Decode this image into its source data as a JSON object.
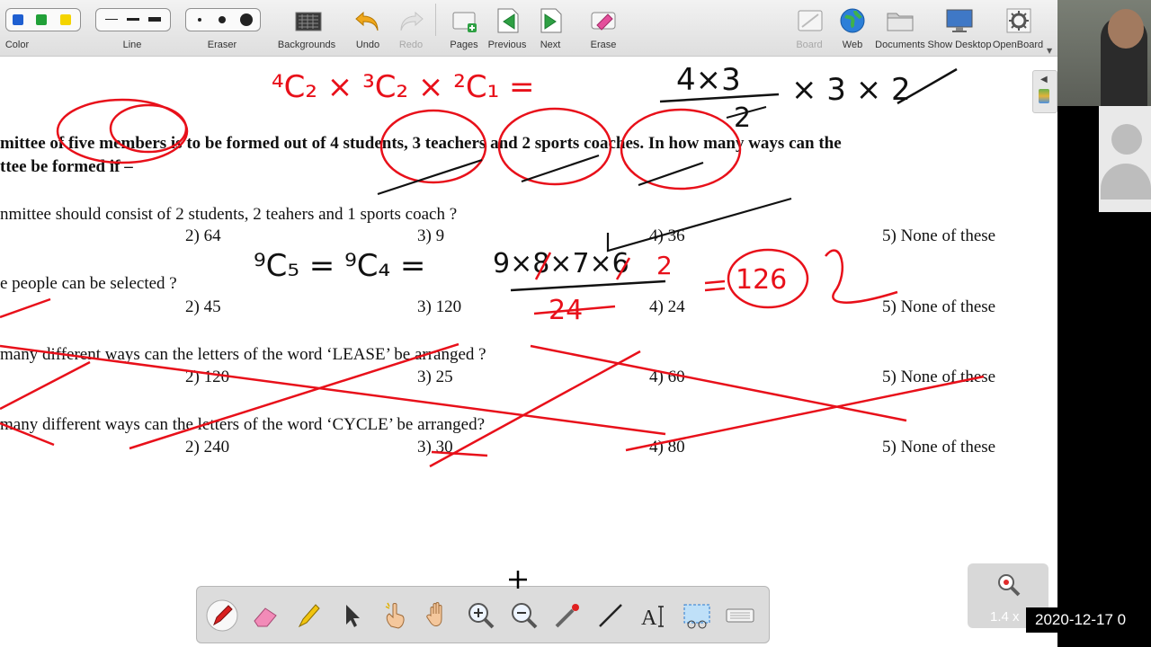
{
  "toolbar": {
    "color_label": "Color",
    "line_label": "Line",
    "eraser_label": "Eraser",
    "backgrounds_label": "Backgrounds",
    "undo_label": "Undo",
    "redo_label": "Redo",
    "pages_label": "Pages",
    "previous_label": "Previous",
    "next_label": "Next",
    "erase_label": "Erase",
    "board_label": "Board",
    "web_label": "Web",
    "documents_label": "Documents",
    "show_desktop_label": "Show Desktop",
    "openboard_label": "OpenBoard",
    "colors": [
      "#1f5fd1",
      "#21a038",
      "#f4d400"
    ],
    "icons": [
      "undo-icon",
      "redo-icon",
      "pages-icon",
      "previous-icon",
      "next-icon",
      "erase-icon",
      "board-icon",
      "web-globe-icon",
      "documents-folder-icon",
      "show-desktop-icon",
      "openboard-gear-icon"
    ]
  },
  "board": {
    "q1_line1": "mittee of five members is to be formed out of 4 students, 3 teachers and 2 sports coaches.  In how many ways can the",
    "q1_line2": "ttee be formed if –",
    "q1a": "nmittee should consist of 2 students, 2 teahers and 1 sports coach  ?",
    "q1a_options": [
      "2)  64",
      "3)  9",
      "4)  36",
      "5) None of these"
    ],
    "q1b": "e people can be selected  ?",
    "q1b_options": [
      "2)  45",
      "3)  120",
      "4)  24",
      "5) None of these"
    ],
    "q2": "many different ways can the letters of the word ‘LEASE’ be arranged ?",
    "q2_options": [
      "2) 120",
      "3)  25",
      "4) 60",
      "5) None of these"
    ],
    "q3": "many different ways can the letters of the word ‘CYCLE’ be arranged?",
    "q3_options": [
      "2)  240",
      "3)  30",
      "4)  80",
      "5) None of these"
    ]
  },
  "ink": {
    "red": "#e8101a",
    "black": "#111111",
    "row1": "⁴C₂ × ³C₂ × ²C₁  =",
    "row1_right": "4×3",
    "row1_den": "2",
    "row1_tail": "× 3  × 2",
    "row2": "⁹C₅ = ⁹C₄ =",
    "row2_num": "9×8×7×6",
    "row2_den": "24",
    "row2_cancel": "2",
    "answer": "126"
  },
  "zoom": {
    "level": "1.4 x"
  },
  "status": {
    "datetime": "2020-12-17 0"
  }
}
